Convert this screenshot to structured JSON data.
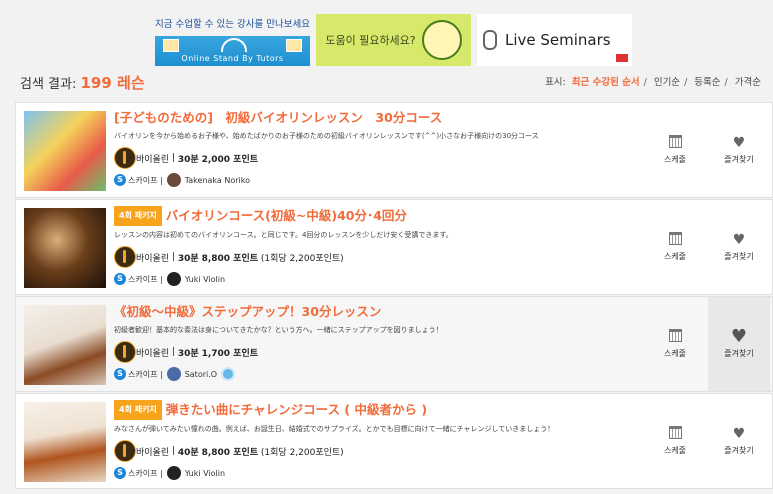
{
  "banners": {
    "tutor": {
      "top_text": "지금 수업할 수 있는 강사를 만나보세요",
      "bottom_text": "Online Stand By Tutors"
    },
    "help": {
      "text": "도움이 필요하세요?"
    },
    "seminars": {
      "text": "Live Seminars"
    }
  },
  "results": {
    "label": "검색 결과:",
    "count": "199 레슨"
  },
  "sort": {
    "label": "표시:",
    "options": [
      "최근 수강된 순서",
      "인기순",
      "등록순",
      "가격순"
    ]
  },
  "actions": {
    "schedule": "스케줄",
    "favorite": "즐겨찾기"
  },
  "lessons": [
    {
      "package": "",
      "title": "[子どものための]　初級バイオリンレッスン　30分コース",
      "desc": "バイオリンを今から始めるお子様や、始めたばかりのお子様のための初級バイオリンレッスンです(^^)小さなお子様向けの30分コース",
      "instrument": "바이올린",
      "duration": "30분",
      "price": "2,000 포인트",
      "extra": "",
      "platform": "스카이프",
      "teacher": "Takenaka Noriko"
    },
    {
      "package": "4회 패키지",
      "title": "バイオリンコース(初級~中級)40分･4回分",
      "desc": "レッスンの内容は初めてのバイオリンコース。と同じです。4回分のレッスンを少しだけ安く受講できます。",
      "instrument": "바이올린",
      "duration": "30분",
      "price": "8,800 포인트",
      "extra": "(1회당 2,200포인트)",
      "platform": "스카이프",
      "teacher": "Yuki Violin"
    },
    {
      "package": "",
      "title": "《初級～中級》ステップアップ！30分レッスン",
      "desc": "初級者歓迎！基本的な奏法は身についてきたかな？という方へ。一緒にステップアップを図りましょう！",
      "instrument": "바이올린",
      "duration": "30분",
      "price": "1,700 포인트",
      "extra": "",
      "platform": "스카이프",
      "teacher": "Satori.O"
    },
    {
      "package": "4회 패키지",
      "title": "弾きたい曲にチャレンジコース ( 中級者から )",
      "desc": "みなさんが弾いてみたい憧れの曲。例えば、お誕生日、結婚式でのサプライズ。とかでも目標に向けて一緒にチャレンジしていきましょう！",
      "instrument": "바이올린",
      "duration": "40분",
      "price": "8,800 포인트",
      "extra": "(1회당 2,200포인트)",
      "platform": "스카이프",
      "teacher": "Yuki Violin"
    }
  ]
}
